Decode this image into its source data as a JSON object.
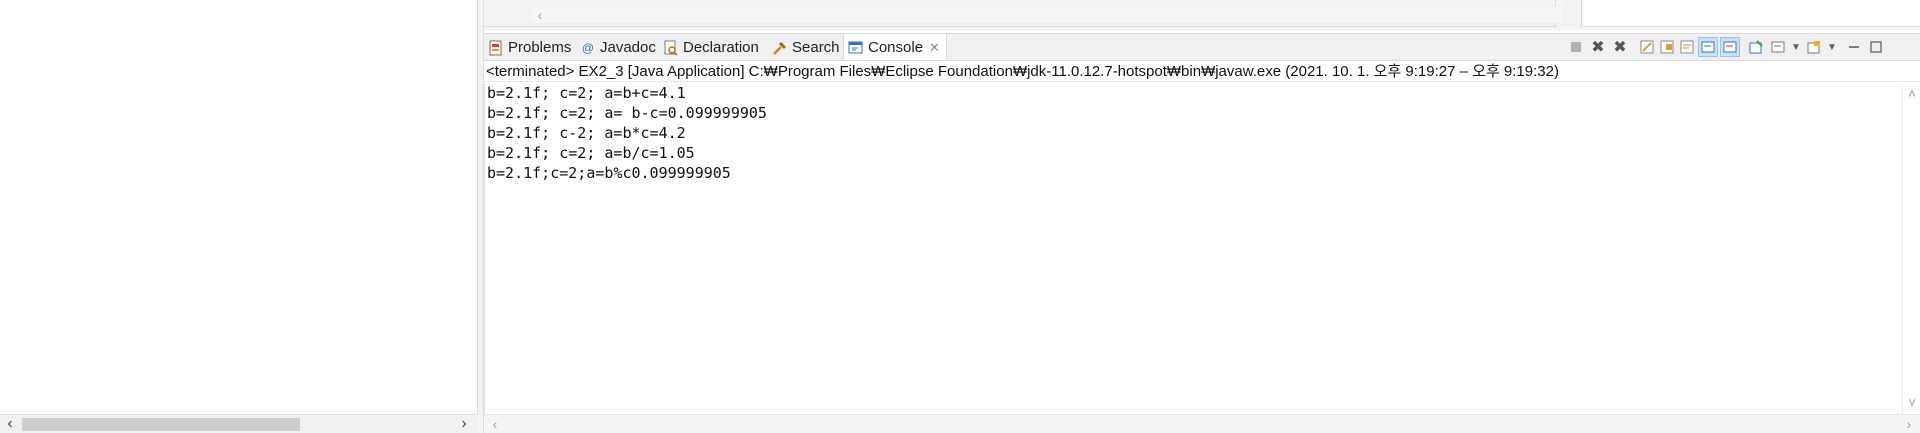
{
  "tabs": [
    {
      "label": "Problems",
      "icon": "problems-icon"
    },
    {
      "label": "Javadoc",
      "icon": "javadoc-icon"
    },
    {
      "label": "Declaration",
      "icon": "declaration-icon"
    },
    {
      "label": "Search",
      "icon": "search-icon"
    },
    {
      "label": "Console",
      "icon": "console-icon",
      "active": true,
      "close": "✕"
    }
  ],
  "console": {
    "header": "<terminated> EX2_3 [Java Application] C:₩Program Files₩Eclipse Foundation₩jdk-11.0.12.7-hotspot₩bin₩javaw.exe  (2021. 10. 1. 오후 9:19:27 – 오후 9:19:32)",
    "lines": [
      "b=2.1f; c=2; a=b+c=4.1",
      "b=2.1f; c=2; a= b-c=0.099999905",
      "b=2.1f; c-2; a=b*c=4.2",
      "b=2.1f; c=2; a=b/c=1.05",
      "b=2.1f;c=2;a=b%c0.099999905"
    ]
  },
  "toolbar_icons": [
    "terminate-icon",
    "remove-launch-icon",
    "remove-all-terminated-icon",
    "clear-console-icon",
    "scroll-lock-icon",
    "word-wrap-icon",
    "show-console-stdout-icon",
    "show-console-stderr-icon",
    "pin-console-icon",
    "display-selected-console-icon",
    "display-dropdown-icon",
    "open-console-icon",
    "open-console-dropdown-icon",
    "minimize-icon",
    "maximize-icon"
  ],
  "colors": {
    "accent": "#3573b9",
    "tab_bg": "#f0f0f0",
    "pressed_bg": "#cce0f5"
  }
}
